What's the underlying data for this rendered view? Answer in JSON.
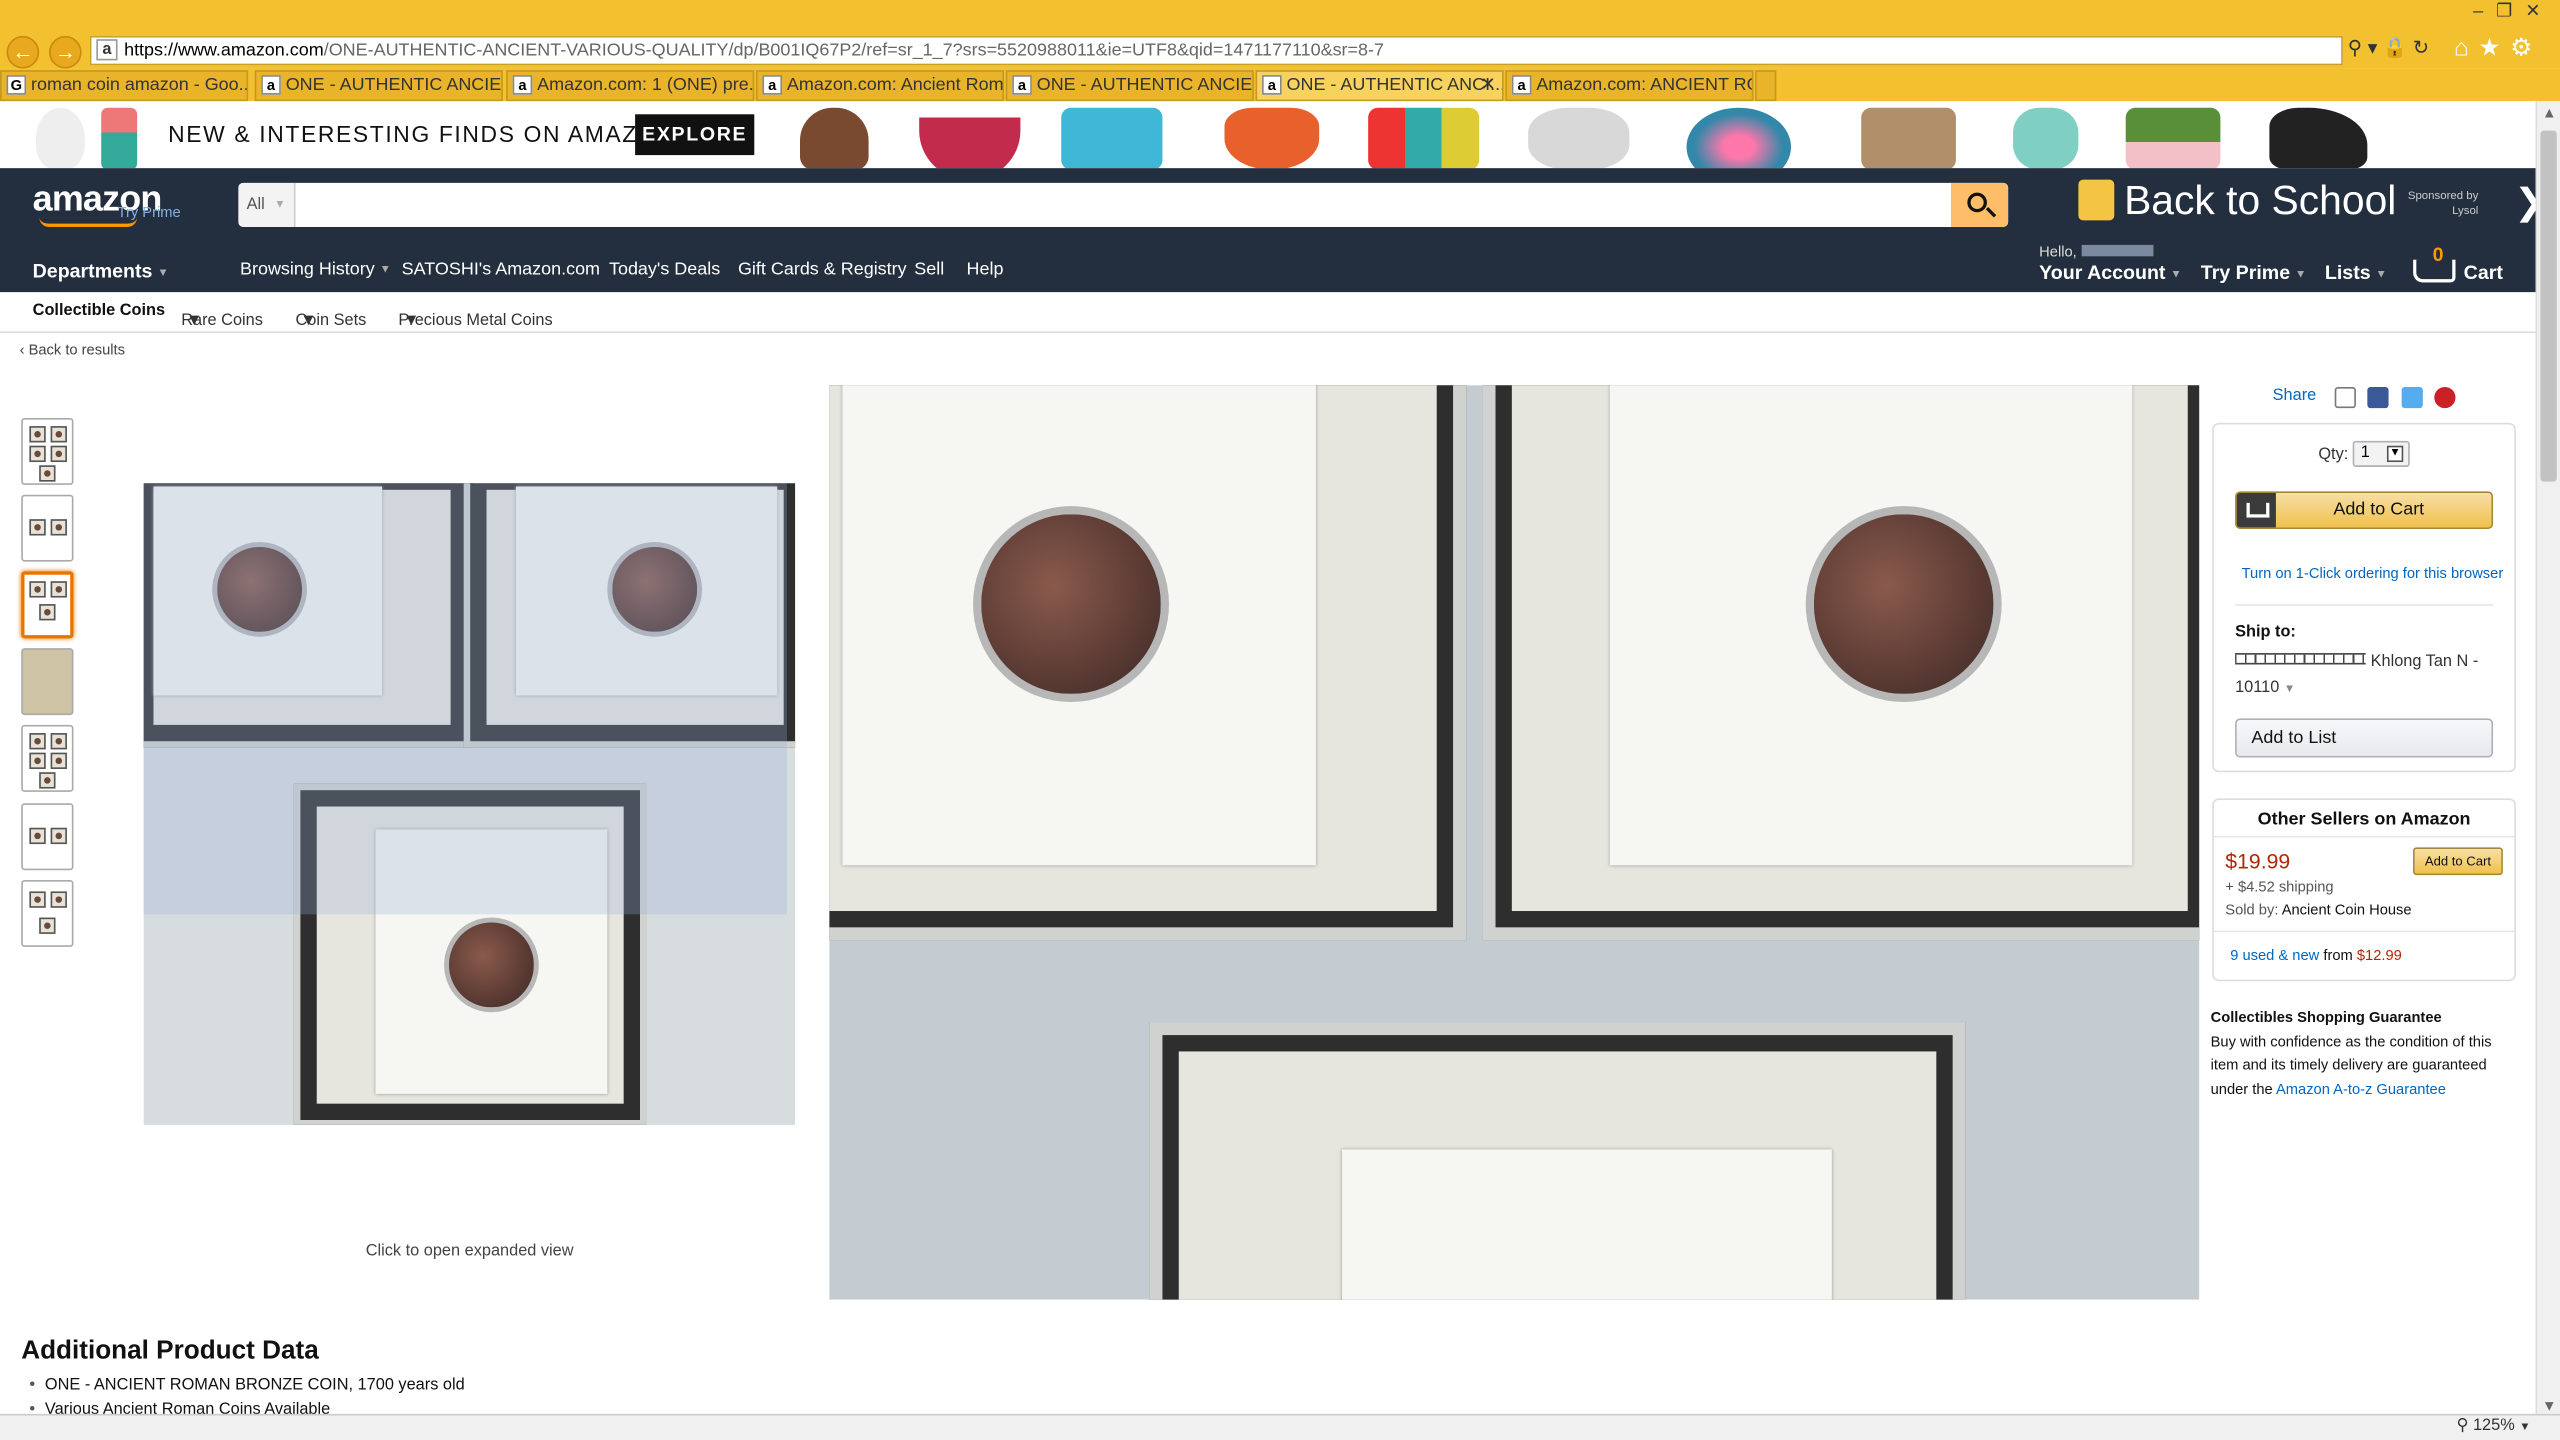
{
  "browser": {
    "url_host": "https://www.amazon.com",
    "url_path": "/ONE-AUTHENTIC-ANCIENT-VARIOUS-QUALITY/dp/B001IQ67P2/ref=sr_1_7?srs=5520988011&ie=UTF8&qid=1471177110&sr=8-7",
    "back_icon": "back-arrow-icon",
    "forward_icon": "forward-arrow-icon",
    "zoom": "125%",
    "tabs": [
      {
        "label": "roman coin amazon - Goo...",
        "icon": "google-icon"
      },
      {
        "label": "ONE - AUTHENTIC ANCIEN...",
        "icon": "amazon-icon"
      },
      {
        "label": "Amazon.com: 1 (ONE) pre...",
        "icon": "amazon-icon"
      },
      {
        "label": "Amazon.com: Ancient Rom...",
        "icon": "amazon-icon"
      },
      {
        "label": "ONE - AUTHENTIC ANCIEN...",
        "icon": "amazon-icon"
      },
      {
        "label": "ONE - AUTHENTIC ANCI...",
        "icon": "amazon-icon",
        "active": true
      },
      {
        "label": "Amazon.com: ANCIENT RO...",
        "icon": "amazon-icon"
      }
    ]
  },
  "promo": {
    "text_a": "NEW & INTERESTING FINDS",
    "text_b": "ON AMAZON",
    "button": "EXPLORE"
  },
  "header": {
    "logo": "amazon",
    "try_prime_small": "Try Prime",
    "search_category": "All",
    "search_placeholder": "",
    "banner": "Back to School",
    "sponsored": "Sponsored by Lysol",
    "departments": "Departments",
    "links": [
      "Browsing History",
      "SATOSHI's Amazon.com",
      "Today's Deals",
      "Gift Cards & Registry",
      "Sell",
      "Help"
    ],
    "hello": "Hello,",
    "account": "Your Account",
    "try_prime": "Try Prime",
    "lists": "Lists",
    "cart_count": "0",
    "cart": "Cart"
  },
  "subnav": {
    "items": [
      "Collectible Coins",
      "Rare Coins",
      "Coin Sets",
      "Precious Metal Coins"
    ]
  },
  "back_link": "Back to results",
  "gallery": {
    "expand_hint": "Click to open expanded view",
    "thumbnail_count": 7,
    "selected_index": 2
  },
  "buybox": {
    "share": "Share",
    "qty_label": "Qty:",
    "qty_value": "1",
    "add_to_cart": "Add to Cart",
    "one_click": "Turn on 1-Click ordering for this browser",
    "ship_to": "Ship to:",
    "ship_city": "Khlong Tan N -",
    "ship_zip": "10110",
    "add_to_list": "Add to List"
  },
  "other_sellers": {
    "title": "Other Sellers on Amazon",
    "price": "$19.99",
    "add_to_cart": "Add to Cart",
    "shipping": "+ $4.52 shipping",
    "sold_by_label": "Sold by:",
    "sold_by": "Ancient Coin House",
    "used_new_link": "9 used & new",
    "from": "from",
    "from_price": "$12.99"
  },
  "guarantee": {
    "title": "Collectibles Shopping Guarantee",
    "text": "Buy with confidence as the condition of this item and its timely delivery are guaranteed under the",
    "link": "Amazon A-to-z Guarantee"
  },
  "product_data": {
    "heading": "Additional Product Data",
    "bullets": [
      "ONE - ANCIENT ROMAN BRONZE COIN, 1700 years old",
      "Various Ancient Roman Coins Available"
    ]
  },
  "colors": {
    "chrome": "#f3c130",
    "nav": "#232f3e",
    "accent": "#f90",
    "link": "#0066c0",
    "price": "#b12704"
  }
}
